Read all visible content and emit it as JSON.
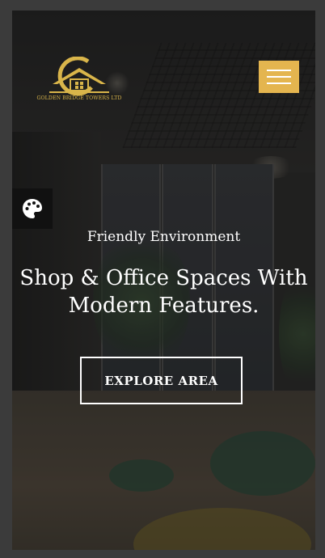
{
  "brand": {
    "name": "GOLDEN BRIDGE TOWERS LTD",
    "logo_icon": "golden-g-house-logo",
    "color": "#d9b54a"
  },
  "menu": {
    "icon": "hamburger-menu-icon",
    "color": "#e4b54f"
  },
  "palette_tab": {
    "icon": "palette-icon"
  },
  "hero": {
    "subtitle": "Friendly Environment",
    "headline": "Shop & Office Spaces With Modern Features.",
    "cta_label": "EXPLORE AREA"
  }
}
